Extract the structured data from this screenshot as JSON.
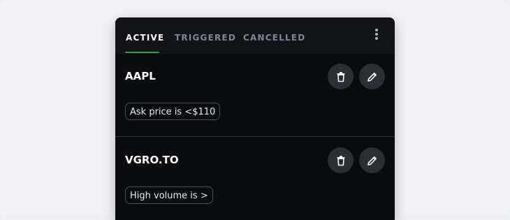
{
  "tabs": [
    {
      "label": "ACTIVE"
    },
    {
      "label": "TRIGGERED"
    },
    {
      "label": "CANCELLED"
    }
  ],
  "menu_icon": "more-vertical-icon",
  "accent_color": "#2ea043",
  "alerts": [
    {
      "symbol": "AAPL",
      "condition": "Ask price is <$110",
      "delete_icon": "trash-icon",
      "edit_icon": "pencil-icon"
    },
    {
      "symbol": "VGRO.TO",
      "condition": "High volume is >",
      "delete_icon": "trash-icon",
      "edit_icon": "pencil-icon"
    }
  ]
}
